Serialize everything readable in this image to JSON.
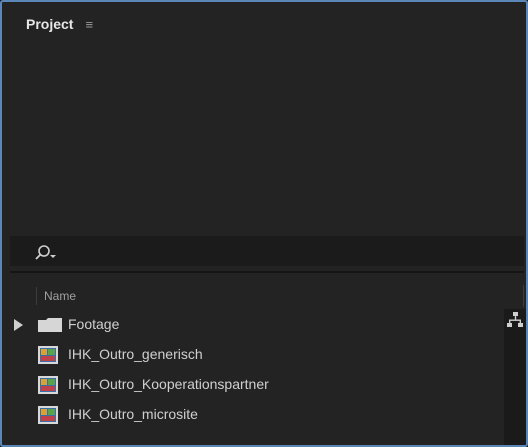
{
  "panel": {
    "title": "Project",
    "menu_icon": "hamburger-menu-icon"
  },
  "search": {
    "icon": "search-icon"
  },
  "columns": {
    "name": "Name"
  },
  "items": [
    {
      "label": "Footage",
      "type": "folder",
      "expanded": false
    },
    {
      "label": "IHK_Outro_generisch",
      "type": "composition"
    },
    {
      "label": "IHK_Outro_Kooperationspartner",
      "type": "composition"
    },
    {
      "label": "IHK_Outro_microsite",
      "type": "composition"
    }
  ],
  "colors": {
    "panel_border": "#5b86b8",
    "panel_bg": "#232323",
    "text": "#d0d0d0"
  }
}
